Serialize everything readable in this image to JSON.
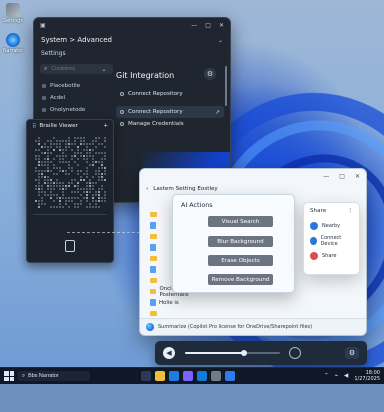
{
  "desktop": {
    "icons": [
      {
        "label": "Settings"
      },
      {
        "label": "Narrator"
      }
    ]
  },
  "settings_window": {
    "breadcrumb": "System > Advanced",
    "subtitle": "Settings",
    "search_placeholder": "Conditions",
    "nav_items": [
      "Placebotile",
      "Acdel",
      "Onolynetode"
    ],
    "section_title": "Git Integration",
    "actions": [
      {
        "label": "Connect Repository"
      },
      {
        "label": "Connect Repository"
      },
      {
        "label": "Manage Credentials"
      }
    ]
  },
  "braille_viewer": {
    "title": "Braille Viewer",
    "plus": "+"
  },
  "explorer": {
    "nav": {
      "back": "‹",
      "crumb": "Lastem  Setting  Eostley"
    },
    "tree": [
      {
        "label": ""
      },
      {
        "label": ""
      },
      {
        "label": ""
      },
      {
        "label": ""
      },
      {
        "label": ""
      },
      {
        "label": ""
      },
      {
        "label": ""
      },
      {
        "label": "Onclonal Postentails"
      },
      {
        "label": "Holie is"
      },
      {
        "label": ""
      }
    ],
    "status": "Summarize (Copilot Pro license for OneDrive/Sharepoint files)"
  },
  "ai_actions": {
    "title": "AI Actions",
    "buttons": [
      {
        "label": "Visual Search"
      },
      {
        "label": "Blur Background"
      },
      {
        "label": "Erase Objects"
      },
      {
        "label": "Remove Background"
      }
    ]
  },
  "share_panel": {
    "title": "Share",
    "more": "⋮",
    "items": [
      {
        "label": "Nearby",
        "color": "#2a79d8"
      },
      {
        "label": "Connect Device",
        "color": "#2a79d8"
      },
      {
        "label": "Share",
        "color": "#e04c4c"
      }
    ]
  },
  "volume": {
    "level": 0.62
  },
  "taskbar": {
    "search_value": "Bbs Narrator",
    "time": "18:00",
    "date": "1/27/2025"
  }
}
